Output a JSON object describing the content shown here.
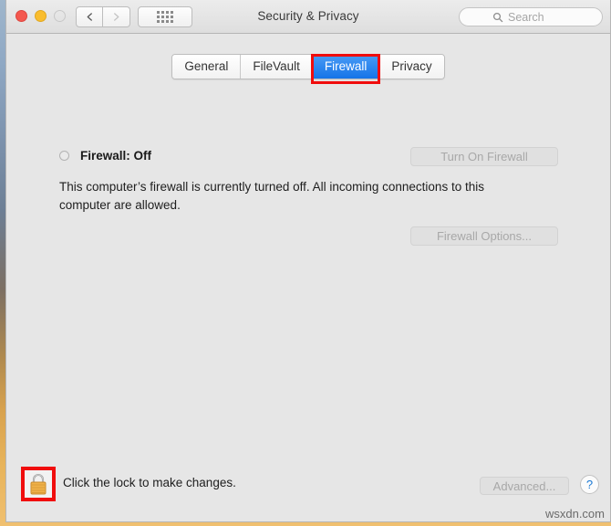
{
  "window": {
    "title": "Security & Privacy",
    "traffic_lights": [
      {
        "name": "close",
        "color": "#f4584f"
      },
      {
        "name": "minimize",
        "color": "#f9bd2e"
      },
      {
        "name": "zoom",
        "color": "transparent"
      }
    ],
    "nav": {
      "back_icon": "chevron-left-icon",
      "forward_icon": "chevron-right-icon"
    },
    "grid_button_icon": "grid-dots-icon"
  },
  "search": {
    "placeholder": "Search",
    "value": "",
    "icon": "search-icon"
  },
  "tabs": [
    {
      "label": "General",
      "active": false
    },
    {
      "label": "FileVault",
      "active": false
    },
    {
      "label": "Firewall",
      "active": true
    },
    {
      "label": "Privacy",
      "active": false
    }
  ],
  "firewall": {
    "status_label": "Firewall: Off",
    "status_indicator": "off",
    "description": "This computer’s firewall is currently turned off. All incoming connections to this computer are allowed.",
    "turn_on_button": "Turn On Firewall",
    "options_button": "Firewall Options...",
    "turn_on_enabled": false,
    "options_enabled": false
  },
  "bottom": {
    "lock_icon": "padlock-closed-icon",
    "lock_text": "Click the lock to make changes.",
    "advanced_button": "Advanced...",
    "advanced_enabled": false,
    "help_button": "?",
    "watermark": "wsxdn.com"
  },
  "colors": {
    "accent_blue": "#1574e8",
    "annotation_red": "#f00d0d",
    "window_bg": "#e6e6e6",
    "lock_gold": "#f0b24a"
  }
}
